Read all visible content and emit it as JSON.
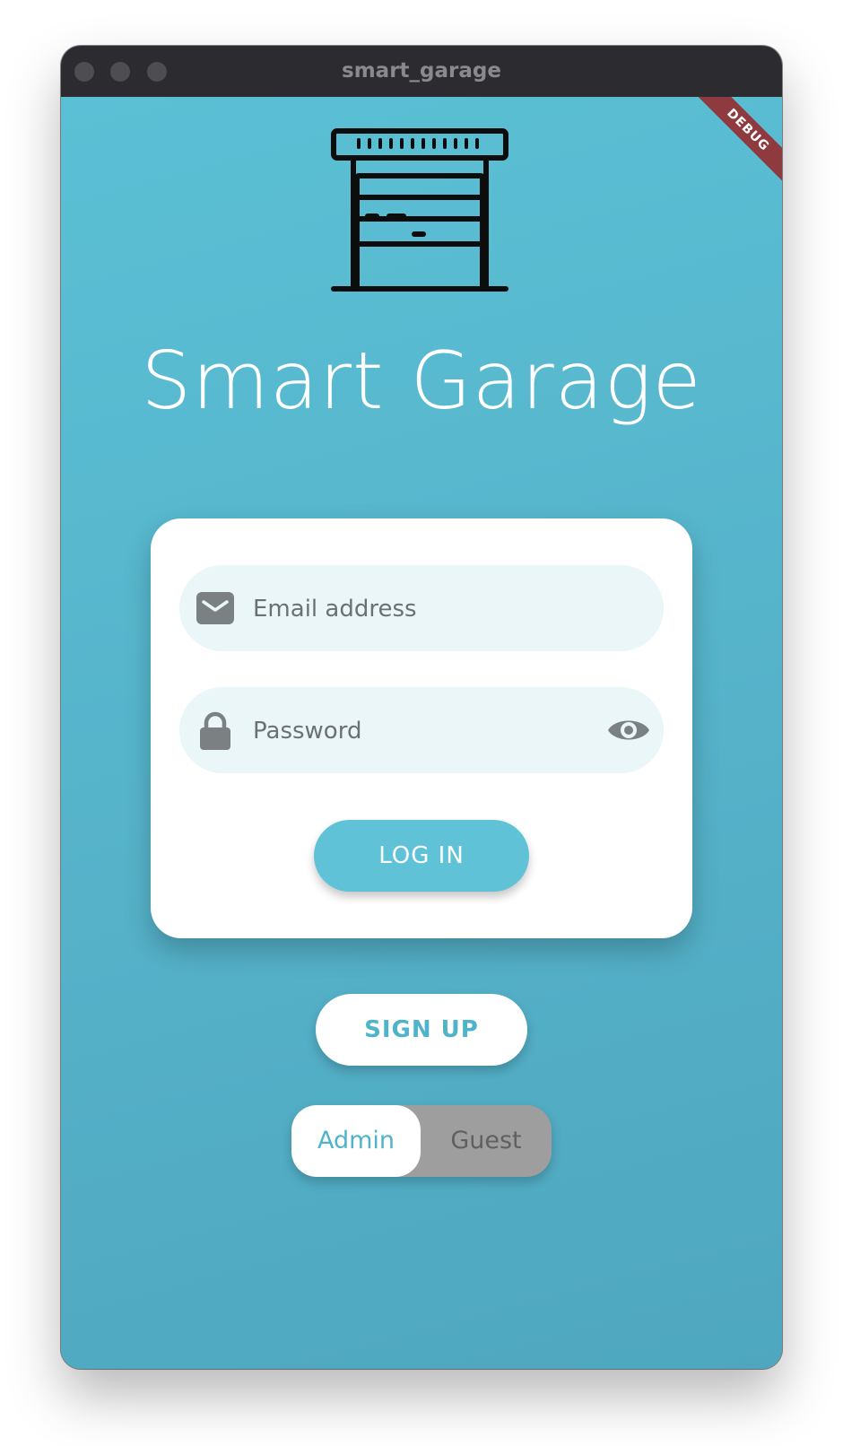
{
  "window": {
    "title": "smart_garage",
    "debug_banner": "DEBUG"
  },
  "app": {
    "title": "Smart Garage",
    "logo_icon": "garage-door-icon"
  },
  "login_card": {
    "email": {
      "placeholder": "Email address",
      "value": "",
      "icon": "envelope-icon"
    },
    "password": {
      "placeholder": "Password",
      "value": "",
      "icon": "lock-icon",
      "toggle_icon": "eye-icon"
    },
    "login_label": "LOG IN"
  },
  "signup_label": "SIGN UP",
  "role_toggle": {
    "options": [
      "Admin",
      "Guest"
    ],
    "selected": "Admin"
  },
  "colors": {
    "background": "#55b5cc",
    "accent": "#5fc2d7",
    "field_bg": "#eaf6f8",
    "debug": "#8e3a3e",
    "toggle_off": "#9e9e9e"
  }
}
